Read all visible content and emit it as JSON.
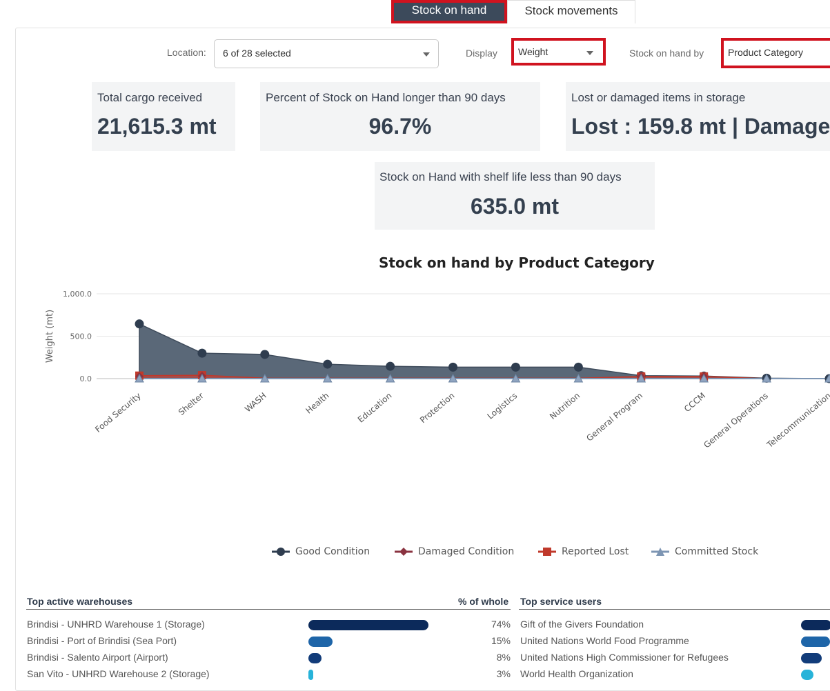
{
  "tabs": [
    {
      "label": "Stock on hand",
      "active": true
    },
    {
      "label": "Stock movements",
      "active": false
    }
  ],
  "filters": {
    "location_label": "Location:",
    "location_value": "6 of 28 selected",
    "display_label": "Display",
    "display_value": "Weight",
    "stock_by_label": "Stock on hand by",
    "stock_by_value": "Product Category"
  },
  "kpis": {
    "total_cargo": {
      "title": "Total cargo received",
      "value": "21,615.3 mt"
    },
    "percent_90": {
      "title": "Percent of Stock on Hand longer than 90 days",
      "value": "96.7%"
    },
    "lost_damaged": {
      "title": "Lost or damaged items in storage",
      "value": "Lost : 159.8 mt | Damage"
    },
    "shelf_life": {
      "title": "Stock on Hand with shelf life less than 90 days",
      "value": "635.0 mt"
    }
  },
  "chart_data": {
    "type": "area",
    "title": "Stock on hand by Product Category",
    "ylabel": "Weight (mt)",
    "ylim": [
      0,
      1000
    ],
    "yticks": [
      "1,000.0",
      "500.0",
      "0.0"
    ],
    "categories": [
      "Food Security",
      "Shelter",
      "WASH",
      "Health",
      "Education",
      "Protection",
      "Logistics",
      "Nutrition",
      "General Program",
      "CCCM",
      "General Operations",
      "Telecommunication"
    ],
    "series": [
      {
        "name": "Good Condition",
        "color": "#2f3d4f",
        "values": [
          645,
          300,
          285,
          170,
          145,
          135,
          135,
          135,
          35,
          30,
          5,
          0
        ]
      },
      {
        "name": "Damaged Condition",
        "color": "#8a3340",
        "values": [
          25,
          30,
          5,
          5,
          5,
          5,
          5,
          5,
          25,
          25,
          0,
          0
        ]
      },
      {
        "name": "Reported Lost",
        "color": "#c0392b",
        "values": [
          35,
          40,
          5,
          5,
          5,
          5,
          5,
          5,
          25,
          25,
          0,
          0
        ]
      },
      {
        "name": "Committed Stock",
        "color": "#7d95b3",
        "values": [
          0,
          0,
          0,
          0,
          0,
          0,
          0,
          0,
          0,
          0,
          0,
          0
        ]
      }
    ],
    "legend_position": "bottom"
  },
  "warehouses": {
    "header": "Top active warehouses",
    "pct_header": "% of whole",
    "rows": [
      {
        "name": "Brindisi - UNHRD Warehouse 1 (Storage)",
        "pct": "74%",
        "fraction": 0.74,
        "color": "#0c2a5b"
      },
      {
        "name": "Brindisi - Port of Brindisi (Sea Port)",
        "pct": "15%",
        "fraction": 0.15,
        "color": "#1e65a8"
      },
      {
        "name": "Brindisi - Salento Airport (Airport)",
        "pct": "8%",
        "fraction": 0.08,
        "color": "#123c7a"
      },
      {
        "name": "San Vito - UNHRD Warehouse 2 (Storage)",
        "pct": "3%",
        "fraction": 0.03,
        "color": "#27b3d9"
      }
    ]
  },
  "service_users": {
    "header": "Top service users",
    "rows": [
      {
        "name": "Gift of the Givers Foundation",
        "color": "#0c2a5b"
      },
      {
        "name": "United Nations World Food Programme",
        "color": "#1e65a8"
      },
      {
        "name": "United Nations High Commissioner for Refugees",
        "color": "#123c7a"
      },
      {
        "name": "World Health Organization",
        "color": "#27b3d9"
      }
    ]
  }
}
